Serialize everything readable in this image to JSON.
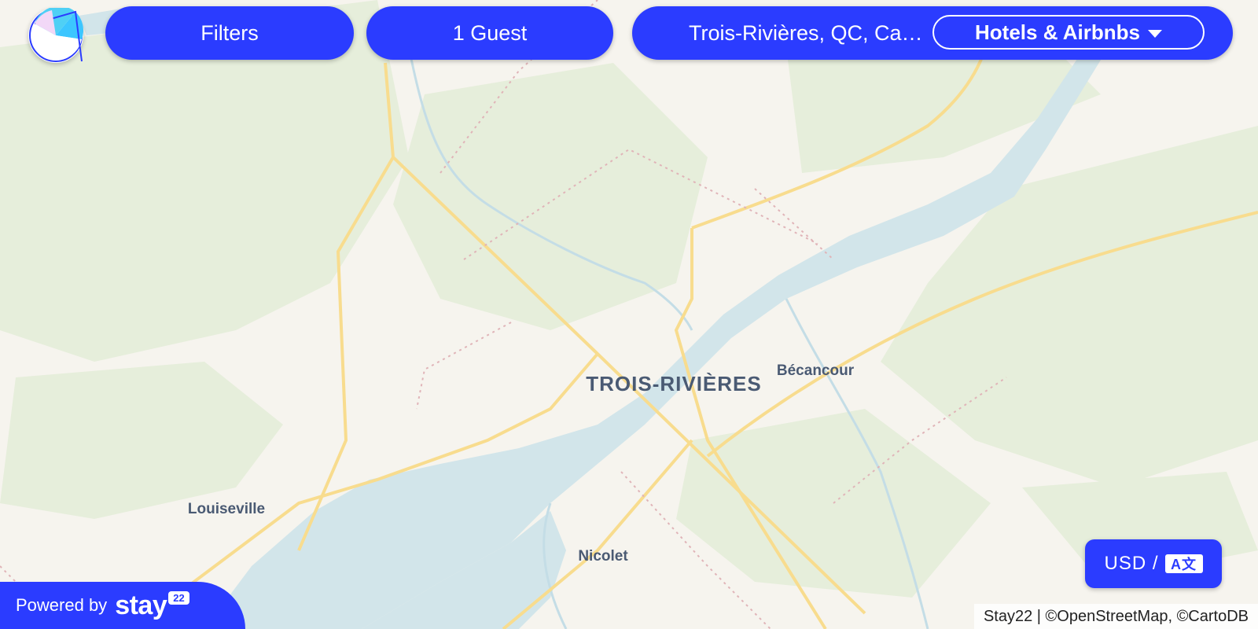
{
  "header": {
    "filters_label": "Filters",
    "guests_label": "1 Guest",
    "location_label": "Trois-Rivières, QC, Can…",
    "type_label": "Hotels & Airbnbs"
  },
  "map": {
    "places": {
      "trois_rivieres": "TROIS-RIVIÈRES",
      "becancour": "Bécancour",
      "louiseville": "Louiseville",
      "nicolet": "Nicolet"
    },
    "colors": {
      "land": "#f6f4ee",
      "forest": "#e6eedb",
      "water": "#d2e5ea",
      "road": "#f8dc8e",
      "boundary": "#e0b4b8"
    }
  },
  "footer": {
    "currency_label": "USD /",
    "translate_icon": "A文",
    "powered_label": "Powered by",
    "brand_name": "stay",
    "brand_badge": "22",
    "attribution": "Stay22 | ©OpenStreetMap, ©CartoDB"
  },
  "theme": {
    "accent": "#2b3cff"
  }
}
